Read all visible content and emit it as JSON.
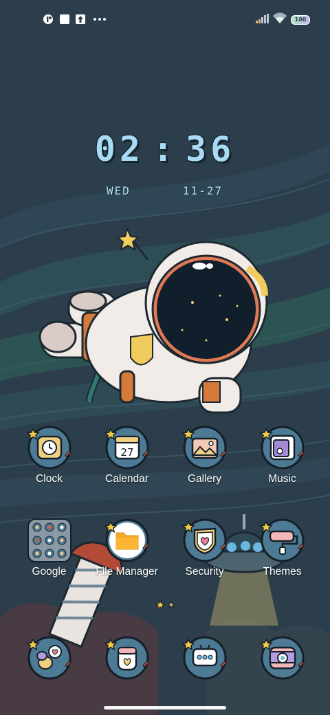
{
  "status_bar": {
    "left_icons": [
      "vpn-key-icon",
      "square-notification-icon",
      "upload-arrow-icon",
      "more-dots-icon"
    ],
    "right_icons": [
      "signal-bars-icon",
      "wifi-icon",
      "battery-icon"
    ],
    "battery_text": "100"
  },
  "lock_clock": {
    "hour": "02",
    "separator": ":",
    "minute": "36",
    "weekday": "WED",
    "date": "11-27"
  },
  "home": {
    "rows": [
      [
        {
          "label": "Clock",
          "icon": "clock-app-icon",
          "starred": true
        },
        {
          "label": "Calendar",
          "icon": "calendar-app-icon",
          "icon_text": "27",
          "starred": true
        },
        {
          "label": "Gallery",
          "icon": "gallery-app-icon",
          "starred": true
        },
        {
          "label": "Music",
          "icon": "music-app-icon",
          "starred": true
        }
      ],
      [
        {
          "label": "Google",
          "icon": "google-folder-icon",
          "starred": false
        },
        {
          "label": "File Manager",
          "icon": "file-manager-app-icon",
          "starred": true
        },
        {
          "label": "Security",
          "icon": "security-app-icon",
          "starred": true
        },
        {
          "label": "Themes",
          "icon": "themes-app-icon",
          "starred": true
        }
      ]
    ],
    "dock": [
      {
        "icon": "game-center-icon",
        "starred": true
      },
      {
        "icon": "phone-app-icon",
        "starred": true
      },
      {
        "icon": "messages-app-icon",
        "starred": true
      },
      {
        "icon": "camera-app-icon",
        "starred": true
      }
    ],
    "page_indicator": {
      "pages": 2,
      "current": 1
    }
  },
  "colors": {
    "background": "#2c3e4b",
    "clock_text": "#a8dcf4",
    "label_text": "#ffffff",
    "icon_bubble": "#4d7a94",
    "star": "#f6c945"
  }
}
